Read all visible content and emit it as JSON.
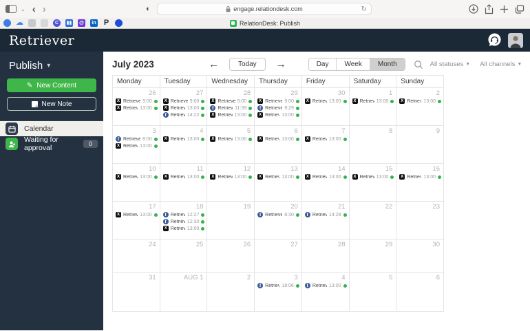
{
  "browser": {
    "url": "engage.relationdesk.com",
    "tab": {
      "title": "RelationDesk: Publish"
    },
    "bookmarks": [
      {
        "name": "pinwheel-favicon",
        "shape": "circle",
        "bg": "#3b7de0",
        "color": "#ffffff",
        "glyph": ""
      },
      {
        "name": "cloud-favicon",
        "shape": "plain",
        "bg": "",
        "color": "#3b82f6",
        "glyph": "☁"
      },
      {
        "name": "clock-app-favicon",
        "shape": "square",
        "bg": "#c7c9ce",
        "color": "#6b7280",
        "glyph": ""
      },
      {
        "name": "gray-app-favicon",
        "shape": "square",
        "bg": "#d6d7da",
        "color": "#9ca3af",
        "glyph": ""
      },
      {
        "name": "c-app-favicon",
        "shape": "circle",
        "bg": "#4f52d9",
        "color": "#ffffff",
        "glyph": "C"
      },
      {
        "name": "boards-app-favicon",
        "shape": "square",
        "bg": "#2f6fdb",
        "color": "#ffffff",
        "glyph": "▮▮"
      },
      {
        "name": "at-app-favicon",
        "shape": "square",
        "bg": "#6d3bd8",
        "color": "#ffffff",
        "glyph": "@"
      },
      {
        "name": "linkedin-favicon",
        "shape": "square",
        "bg": "#0a66c2",
        "color": "#ffffff",
        "glyph": "in"
      },
      {
        "name": "p-letter-favicon",
        "shape": "plain",
        "bg": "",
        "color": "#1f2937",
        "glyph": "P"
      },
      {
        "name": "blue-dot-favicon",
        "shape": "circle",
        "bg": "#1d4fd8",
        "color": "#ffffff",
        "glyph": ""
      }
    ]
  },
  "header": {
    "logo": "Retriever"
  },
  "sidebar": {
    "section_label": "Publish",
    "new_content_label": "New Content",
    "new_note_label": "New Note",
    "items": [
      {
        "label": "Calendar",
        "active": true
      },
      {
        "label": "Waiting for approval",
        "badge": "0"
      }
    ]
  },
  "toolbar": {
    "title": "July 2023",
    "today_label": "Today",
    "views": [
      "Day",
      "Week",
      "Month"
    ],
    "active_view": "Month",
    "status_filter": "All statuses",
    "channel_filter": "All channels"
  },
  "colors": {
    "accent_green": "#3eb649",
    "status_dot_green": "#35b34a",
    "x_black": "#111111",
    "facebook_blue": "#3b5998",
    "sidebar_navy": "#233140",
    "header_navy": "#1b2835"
  },
  "calendar": {
    "day_headers": [
      "Monday",
      "Tuesday",
      "Wednesday",
      "Thursday",
      "Friday",
      "Saturday",
      "Sunday"
    ],
    "weeks": [
      {
        "days": [
          {
            "date": "26",
            "events": [
              {
                "net": "x",
                "title": "Retriever ...",
                "time": "9:00"
              },
              {
                "net": "x",
                "title": "Retriever ...",
                "time": "13:00"
              }
            ]
          },
          {
            "date": "27",
            "events": [
              {
                "net": "x",
                "title": "Retriever ...",
                "time": "9:00"
              },
              {
                "net": "x",
                "title": "Retriever ...",
                "time": "13:00"
              },
              {
                "net": "fb",
                "title": "Retriever ...",
                "time": "14:22"
              }
            ]
          },
          {
            "date": "28",
            "events": [
              {
                "net": "x",
                "title": "Retriever ...",
                "time": "9:00"
              },
              {
                "net": "fb",
                "title": "Retriever ...",
                "time": "11:39"
              },
              {
                "net": "x",
                "title": "Retriever ...",
                "time": "13:00"
              }
            ]
          },
          {
            "date": "29",
            "events": [
              {
                "net": "x",
                "title": "Retriever ...",
                "time": "9:00"
              },
              {
                "net": "fb",
                "title": "Retriever ...",
                "time": "9:29"
              },
              {
                "net": "x",
                "title": "Retriever ...",
                "time": "13:00"
              }
            ]
          },
          {
            "date": "30",
            "events": [
              {
                "net": "x",
                "title": "Retriever ...",
                "time": "13:00"
              }
            ]
          },
          {
            "date": "1",
            "events": [
              {
                "net": "x",
                "title": "Retriever ...",
                "time": "13:00"
              }
            ]
          },
          {
            "date": "2",
            "events": [
              {
                "net": "x",
                "title": "Retriever ...",
                "time": "13:00"
              }
            ]
          }
        ]
      },
      {
        "days": [
          {
            "date": "3",
            "events": [
              {
                "net": "fb",
                "title": "Retriever ...",
                "time": "8:00"
              },
              {
                "net": "x",
                "title": "Retriever ...",
                "time": "13:00"
              }
            ]
          },
          {
            "date": "4",
            "events": [
              {
                "net": "x",
                "title": "Retriever ...",
                "time": "13:00"
              }
            ]
          },
          {
            "date": "5",
            "events": [
              {
                "net": "x",
                "title": "Retriever ...",
                "time": "13:00"
              }
            ]
          },
          {
            "date": "6",
            "events": [
              {
                "net": "x",
                "title": "Retriever ...",
                "time": "13:00"
              }
            ]
          },
          {
            "date": "7",
            "events": [
              {
                "net": "x",
                "title": "Retriever ...",
                "time": "13:00"
              }
            ]
          },
          {
            "date": "8",
            "events": []
          },
          {
            "date": "9",
            "events": []
          }
        ]
      },
      {
        "days": [
          {
            "date": "10",
            "events": [
              {
                "net": "x",
                "title": "Retriever ...",
                "time": "13:00"
              }
            ]
          },
          {
            "date": "11",
            "events": [
              {
                "net": "x",
                "title": "Retriever ...",
                "time": "13:00"
              }
            ]
          },
          {
            "date": "12",
            "events": [
              {
                "net": "x",
                "title": "Retriever ...",
                "time": "13:00"
              }
            ]
          },
          {
            "date": "13",
            "events": [
              {
                "net": "x",
                "title": "Retriever ...",
                "time": "13:00"
              }
            ]
          },
          {
            "date": "14",
            "events": [
              {
                "net": "x",
                "title": "Retriever ...",
                "time": "13:00"
              }
            ]
          },
          {
            "date": "15",
            "events": [
              {
                "net": "x",
                "title": "Retriever ...",
                "time": "13:00"
              }
            ]
          },
          {
            "date": "16",
            "events": [
              {
                "net": "x",
                "title": "Retriever ...",
                "time": "13:00"
              }
            ]
          }
        ]
      },
      {
        "days": [
          {
            "date": "17",
            "events": [
              {
                "net": "x",
                "title": "Retriever ...",
                "time": "13:00"
              }
            ]
          },
          {
            "date": "18",
            "events": [
              {
                "net": "fb",
                "title": "Retriever ...",
                "time": "12:27"
              },
              {
                "net": "fb",
                "title": "Retriever ...",
                "time": "12:30"
              },
              {
                "net": "x",
                "title": "Retriever ...",
                "time": "13:00"
              }
            ]
          },
          {
            "date": "19",
            "events": []
          },
          {
            "date": "20",
            "events": [
              {
                "net": "fb",
                "title": "Retriever ...",
                "time": "8:30"
              }
            ]
          },
          {
            "date": "21",
            "events": [
              {
                "net": "fb",
                "title": "Retriever ...",
                "time": "14:28"
              }
            ]
          },
          {
            "date": "22",
            "events": []
          },
          {
            "date": "23",
            "events": []
          }
        ]
      },
      {
        "days": [
          {
            "date": "24",
            "events": []
          },
          {
            "date": "25",
            "events": []
          },
          {
            "date": "26",
            "events": []
          },
          {
            "date": "27",
            "events": []
          },
          {
            "date": "28",
            "events": []
          },
          {
            "date": "29",
            "events": []
          },
          {
            "date": "30",
            "events": []
          }
        ]
      },
      {
        "days": [
          {
            "date": "31",
            "events": []
          },
          {
            "date": "AUG 1",
            "events": []
          },
          {
            "date": "2",
            "events": []
          },
          {
            "date": "3",
            "events": [
              {
                "net": "fb",
                "title": "Retriever ...",
                "time": "18:06"
              }
            ]
          },
          {
            "date": "4",
            "events": [
              {
                "net": "fb",
                "title": "Retriever ...",
                "time": "13:00"
              }
            ]
          },
          {
            "date": "5",
            "events": []
          },
          {
            "date": "6",
            "events": []
          }
        ]
      }
    ]
  }
}
